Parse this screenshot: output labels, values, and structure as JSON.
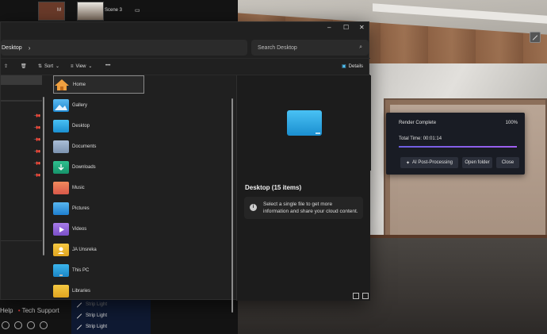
{
  "host": {
    "top_label_1": "M",
    "scene_label": "Scene 3",
    "help_label": "Help",
    "tech_support_label": "Tech Support",
    "strip_items": [
      "Strip Light",
      "Strip Light",
      "Strip Light"
    ]
  },
  "explorer": {
    "window_controls": [
      "–",
      "☐",
      "✕"
    ],
    "address": "Desktop",
    "search_placeholder": "Search Desktop",
    "toolbar": {
      "sort_label": "Sort",
      "view_label": "View",
      "more_label": "•••",
      "details_label": "Details"
    },
    "files": [
      {
        "name": "Home",
        "icon": "home-icon"
      },
      {
        "name": "Gallery",
        "icon": "gallery-icon"
      },
      {
        "name": "Desktop",
        "icon": "desktop-folder-icon"
      },
      {
        "name": "Documents",
        "icon": "documents-folder-icon"
      },
      {
        "name": "Downloads",
        "icon": "downloads-folder-icon"
      },
      {
        "name": "Music",
        "icon": "music-folder-icon"
      },
      {
        "name": "Pictures",
        "icon": "pictures-folder-icon"
      },
      {
        "name": "Videos",
        "icon": "videos-folder-icon"
      },
      {
        "name": "JA Unsreka",
        "icon": "user-folder-icon"
      },
      {
        "name": "This PC",
        "icon": "this-pc-icon"
      },
      {
        "name": "Libraries",
        "icon": "libraries-folder-icon"
      }
    ],
    "details": {
      "title": "Desktop (15 items)",
      "info": "Select a single file to get more information and share your cloud content."
    }
  },
  "render_dialog": {
    "title": "Render Complete",
    "percent": "100%",
    "progress": 1.0,
    "time_label": "Total Time:",
    "time_value": "00:01:14",
    "ai_button": "AI Post-Processing",
    "open_button": "Open folder",
    "close_button": "Close",
    "accent_color": "#8b5cf6"
  }
}
